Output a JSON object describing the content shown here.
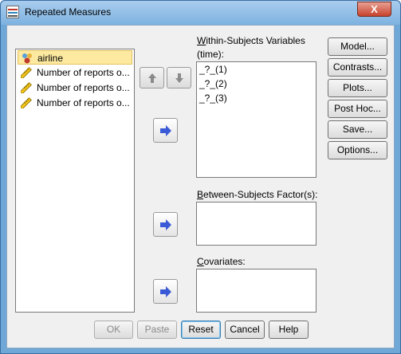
{
  "window": {
    "title": "Repeated Measures",
    "close_label": "X"
  },
  "source_list": {
    "items": [
      {
        "label": "airline",
        "icon": "nominal-variable-icon",
        "selected": true
      },
      {
        "label": "Number of reports o...",
        "icon": "scale-variable-icon",
        "selected": false
      },
      {
        "label": "Number of reports o...",
        "icon": "scale-variable-icon",
        "selected": false
      },
      {
        "label": "Number of reports o...",
        "icon": "scale-variable-icon",
        "selected": false
      }
    ]
  },
  "within": {
    "label_prefix": "W",
    "label_rest": "ithin-Subjects Variables",
    "factor": "(time):",
    "items": [
      "_?_(1)",
      "_?_(2)",
      "_?_(3)"
    ]
  },
  "between": {
    "label_prefix": "B",
    "label_rest": "etween-Subjects Factor(s):"
  },
  "covariates": {
    "label_prefix": "C",
    "label_rest": "ovariates:"
  },
  "side_buttons": {
    "model": "Model...",
    "contrasts": "Contrasts...",
    "plots": "Plots...",
    "post_hoc": "Post Hoc...",
    "save": "Save...",
    "options": "Options..."
  },
  "bottom_buttons": {
    "ok": "OK",
    "paste": "Paste",
    "reset": "Reset",
    "cancel": "Cancel",
    "help": "Help"
  },
  "colors": {
    "arrow": "#3b5bd6",
    "selected_bg": "#fdeaa0"
  }
}
